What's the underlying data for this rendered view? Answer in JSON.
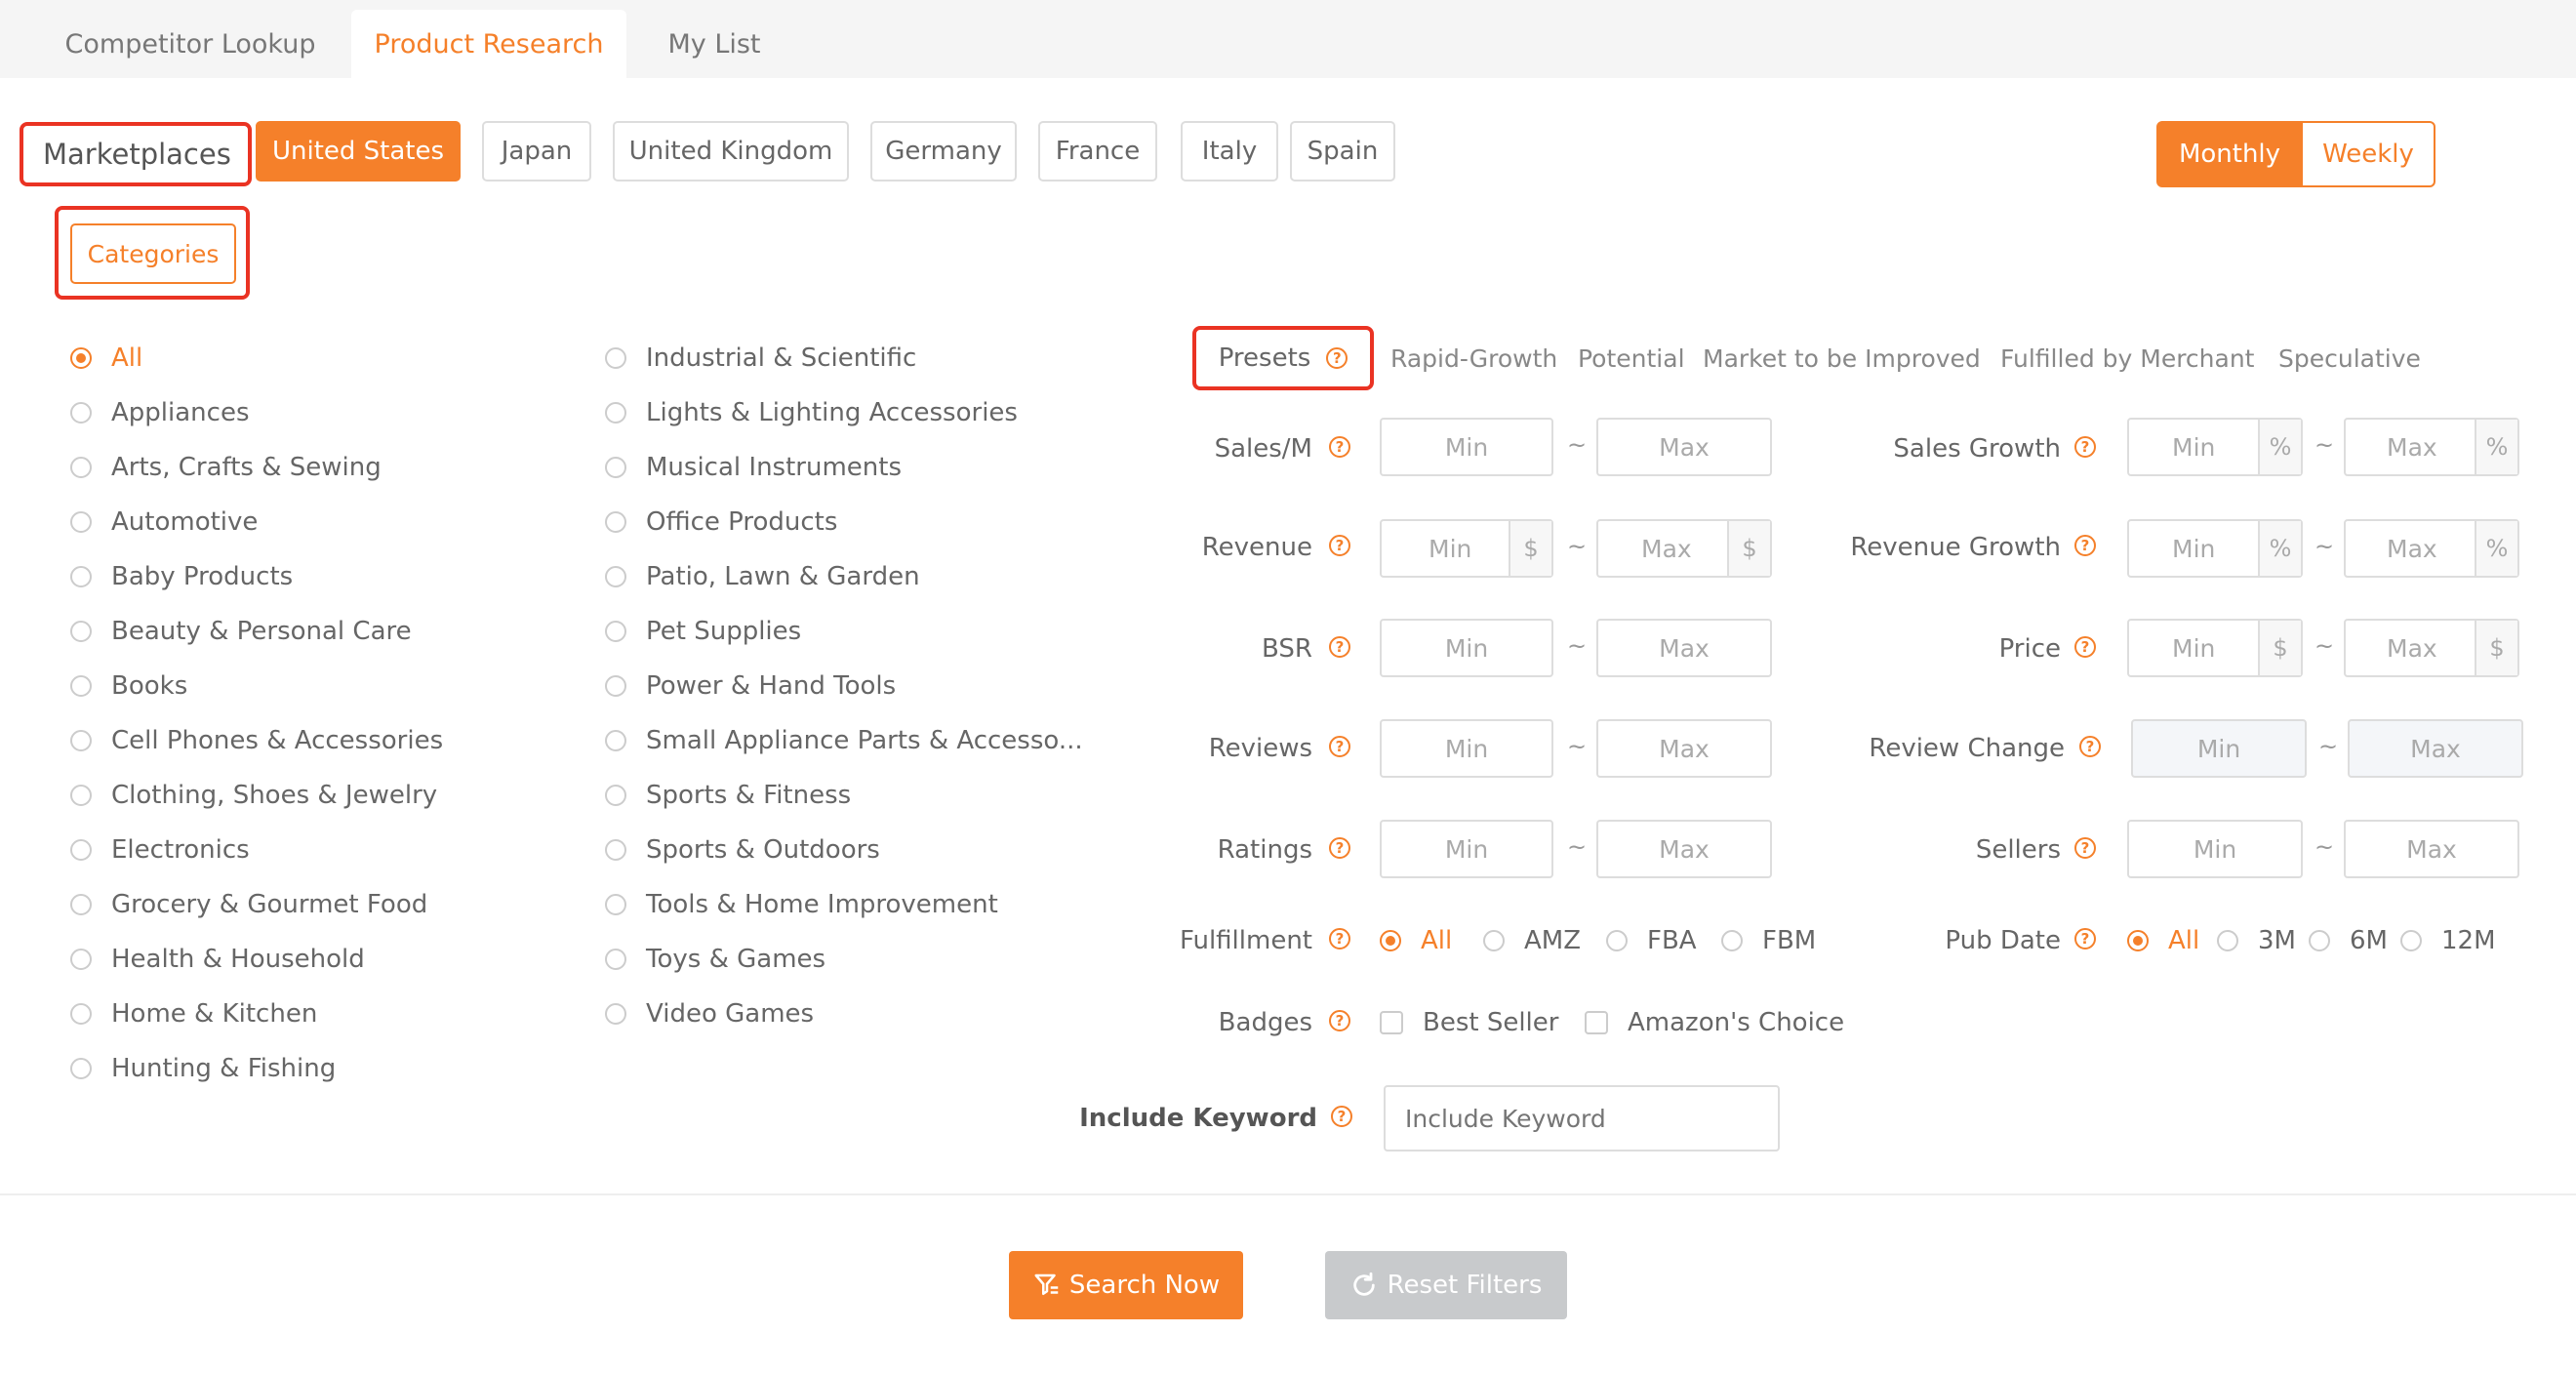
{
  "tabs": [
    {
      "label": "Competitor Lookup"
    },
    {
      "label": "Product Research"
    },
    {
      "label": "My List"
    }
  ],
  "marketplaces": {
    "label": "Marketplaces",
    "items": [
      "United States",
      "Japan",
      "United Kingdom",
      "Germany",
      "France",
      "Italy",
      "Spain"
    ],
    "selected": "United States"
  },
  "period": {
    "monthly": "Monthly",
    "weekly": "Weekly",
    "selected": "Monthly"
  },
  "categories": {
    "button": "Categories",
    "left": [
      "All",
      "Appliances",
      "Arts, Crafts & Sewing",
      "Automotive",
      "Baby Products",
      "Beauty & Personal Care",
      "Books",
      "Cell Phones & Accessories",
      "Clothing, Shoes & Jewelry",
      "Electronics",
      "Grocery & Gourmet Food",
      "Health & Household",
      "Home & Kitchen",
      "Hunting & Fishing"
    ],
    "right": [
      "Industrial & Scientific",
      "Lights & Lighting Accessories",
      "Musical Instruments",
      "Office Products",
      "Patio, Lawn & Garden",
      "Pet Supplies",
      "Power & Hand Tools",
      "Small Appliance Parts & Accesso...",
      "Sports & Fitness",
      "Sports & Outdoors",
      "Tools & Home Improvement",
      "Toys & Games",
      "Video Games"
    ],
    "selected": "All"
  },
  "presets": {
    "label": "Presets",
    "options": [
      "Rapid-Growth",
      "Potential",
      "Market to be Improved",
      "Fulfilled by Merchant",
      "Speculative"
    ]
  },
  "filters": {
    "min": "Min",
    "max": "Max",
    "tilde": "~",
    "sales_m": "Sales/M",
    "revenue": "Revenue",
    "bsr": "BSR",
    "reviews": "Reviews",
    "ratings": "Ratings",
    "sales_growth": "Sales Growth",
    "revenue_growth": "Revenue Growth",
    "price": "Price",
    "review_change": "Review Change",
    "sellers": "Sellers",
    "percent": "%",
    "dollar": "$"
  },
  "fulfillment": {
    "label": "Fulfillment",
    "options": [
      "All",
      "AMZ",
      "FBA",
      "FBM"
    ],
    "selected": "All"
  },
  "pub_date": {
    "label": "Pub Date",
    "options": [
      "All",
      "3M",
      "6M",
      "12M"
    ],
    "selected": "All"
  },
  "badges": {
    "label": "Badges",
    "options": [
      "Best Seller",
      "Amazon's Choice"
    ]
  },
  "include_keyword": {
    "label": "Include Keyword",
    "placeholder": "Include Keyword"
  },
  "actions": {
    "search": "Search Now",
    "reset": "Reset Filters"
  },
  "colors": {
    "accent": "#f5802a",
    "highlight": "#ea3323",
    "disabled": "#c8cacc"
  }
}
